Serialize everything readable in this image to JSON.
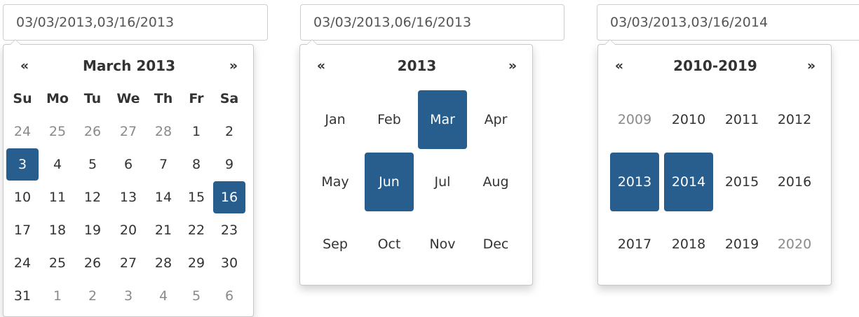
{
  "inputs": [
    {
      "value": "03/03/2013,03/16/2013"
    },
    {
      "value": "03/03/2013,06/16/2013"
    },
    {
      "value": "03/03/2013,03/16/2014"
    }
  ],
  "days_picker": {
    "prev": "«",
    "title": "March 2013",
    "next": "»",
    "dow": [
      "Su",
      "Mo",
      "Tu",
      "We",
      "Th",
      "Fr",
      "Sa"
    ],
    "weeks": [
      [
        "24",
        "25",
        "26",
        "27",
        "28",
        "1",
        "2"
      ],
      [
        "3",
        "4",
        "5",
        "6",
        "7",
        "8",
        "9"
      ],
      [
        "10",
        "11",
        "12",
        "13",
        "14",
        "15",
        "16"
      ],
      [
        "17",
        "18",
        "19",
        "20",
        "21",
        "22",
        "23"
      ],
      [
        "24",
        "25",
        "26",
        "27",
        "28",
        "29",
        "30"
      ],
      [
        "31",
        "1",
        "2",
        "3",
        "4",
        "5",
        "6"
      ]
    ],
    "muted_cells": [
      "0-0",
      "0-1",
      "0-2",
      "0-3",
      "0-4",
      "5-1",
      "5-2",
      "5-3",
      "5-4",
      "5-5",
      "5-6"
    ],
    "selected_cells": [
      "1-0",
      "2-6"
    ]
  },
  "months_picker": {
    "prev": "«",
    "title": "2013",
    "next": "»",
    "months": [
      [
        "Jan",
        "Feb",
        "Mar",
        "Apr"
      ],
      [
        "May",
        "Jun",
        "Jul",
        "Aug"
      ],
      [
        "Sep",
        "Oct",
        "Nov",
        "Dec"
      ]
    ],
    "selected": [
      "Mar",
      "Jun"
    ]
  },
  "years_picker": {
    "prev": "«",
    "title": "2010-2019",
    "next": "»",
    "years": [
      [
        "2009",
        "2010",
        "2011",
        "2012"
      ],
      [
        "2013",
        "2014",
        "2015",
        "2016"
      ],
      [
        "2017",
        "2018",
        "2019",
        "2020"
      ]
    ],
    "muted": [
      "2009",
      "2020"
    ],
    "selected": [
      "2013",
      "2014"
    ]
  },
  "colors": {
    "selected_bg": "#285e8e",
    "selected_text": "#ffffff",
    "muted_text": "#8a8a8a",
    "text": "#333333"
  }
}
